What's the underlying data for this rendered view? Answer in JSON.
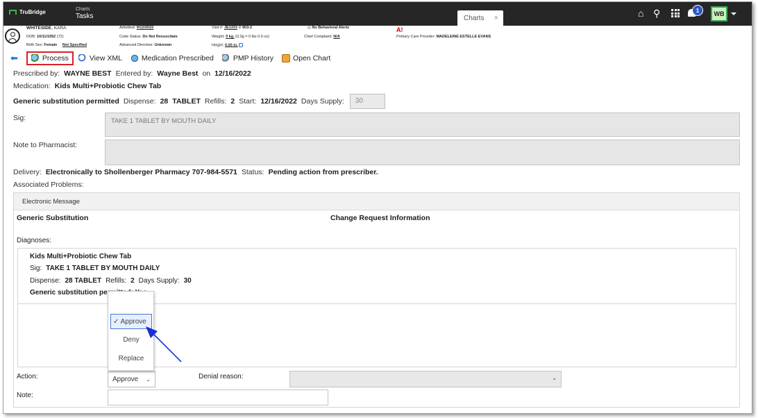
{
  "topbar": {
    "logo": "TruBridge",
    "crumb_parent": "Charts",
    "crumb_current": "Tasks",
    "tab_label": "Charts",
    "tab_close": "×",
    "notification_count": "1",
    "user_initials": "WB"
  },
  "patient": {
    "name_last": "WHITESIDE",
    "name_first": ", KARA",
    "dob_label": "DOB:",
    "dob_value": "10/11/1952",
    "age": "(72)",
    "birth_sex_label": "Birth Sex:",
    "birth_sex_value": "Female",
    "birth_sex_extra": "Not Specified",
    "admitted_label": "Admitted:",
    "admitted_value": "9/12/2022",
    "code_status_label": "Code Status:",
    "code_status_value": "Do Not Resuscitate",
    "adv_directive_label": "Advanced Directive:",
    "adv_directive_value": "Unknown",
    "visit_label": "Visit #:",
    "visit_value": "JE1333",
    "room_value": "903-2",
    "weight_label": "Weight:",
    "weight_value": "0 kg.",
    "weight_extra": "(0.0g = 0 lbs 0.0 oz)",
    "height_label": "Height:",
    "height_value": "0.00 in.",
    "behavioral_alerts": "No Behavioral Alerts",
    "chief_complaint_label": "Chief Complaint:",
    "chief_complaint_value": "N/A",
    "pcp_label": "Primary Care Provider:",
    "pcp_value": "MADELEINE ESTELLE EVANS"
  },
  "toolbar": {
    "process": "Process",
    "view_xml": "View XML",
    "medication_prescribed": "Medication Prescribed",
    "pmp_history": "PMP History",
    "open_chart": "Open Chart"
  },
  "rx": {
    "prescribed_by_label": "Prescribed by:",
    "prescribed_by": "WAYNE BEST",
    "entered_by_label": "Entered by:",
    "entered_by": "Wayne Best",
    "on_label": "on",
    "date": "12/16/2022",
    "medication_label": "Medication:",
    "medication": "Kids Multi+Probiotic Chew Tab",
    "generic": "Generic substitution permitted",
    "dispense_label": "Dispense:",
    "dispense_qty": "28",
    "dispense_unit": "TABLET",
    "refills_label": "Refills:",
    "refills": "2",
    "start_label": "Start:",
    "start": "12/16/2022",
    "days_supply_label": "Days Supply:",
    "days_supply": "30",
    "sig_label": "Sig:",
    "sig": "TAKE 1 TABLET BY MOUTH DAILY",
    "note_label": "Note to Pharmacist:",
    "delivery_label": "Delivery:",
    "delivery": "Electronically to Shollenberger Pharmacy 707-984-5571",
    "status_label": "Status:",
    "status": "Pending action from prescriber.",
    "assoc_label": "Associated Problems:"
  },
  "message": {
    "header": "Electronic Message",
    "col_left": "Generic Substitution",
    "col_right": "Change Request Information",
    "diagnoses_label": "Diagnoses:",
    "med_name": "Kids Multi+Probiotic Chew Tab",
    "sig_label": "Sig:",
    "sig": "TAKE 1 TABLET BY MOUTH DAILY",
    "dispense_label": "Dispense:",
    "dispense": "28 TABLET",
    "refills_label": "Refills:",
    "refills": "2",
    "days_label": "Days Supply:",
    "days": "30",
    "generic": "Generic substitution permitted: Yes"
  },
  "form": {
    "action_label": "Action:",
    "action_value": "Approve",
    "denial_label": "Denial reason:",
    "note_label": "Note:",
    "options": [
      "Approve",
      "Deny",
      "Replace"
    ],
    "selected_mark": "✓"
  }
}
